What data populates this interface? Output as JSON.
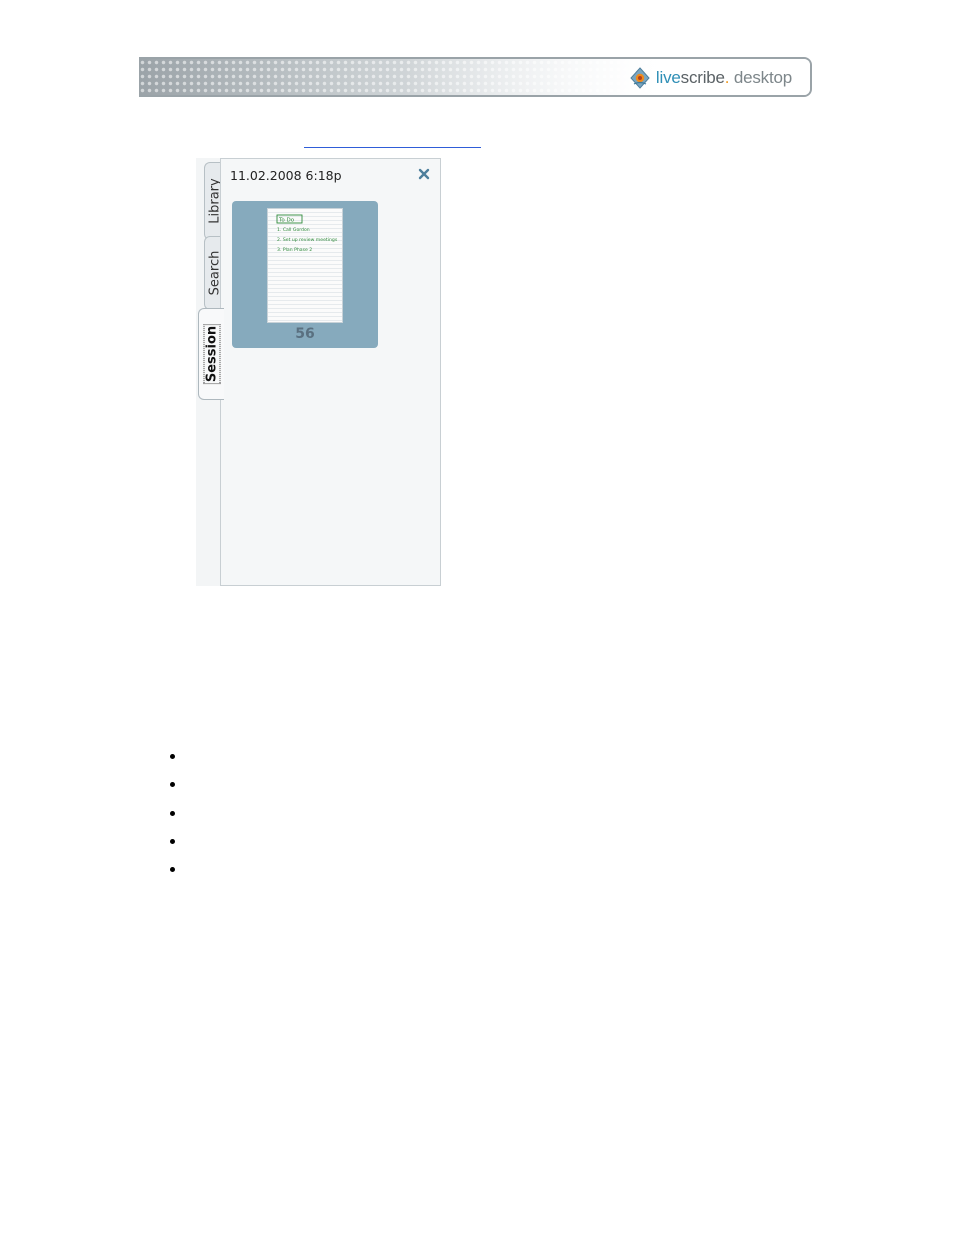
{
  "header": {
    "logo_live": "live",
    "logo_scribe": "scribe",
    "logo_dot": ".",
    "logo_desktop": " desktop",
    "logo_icon": "livescribe-pen-icon",
    "accent_color": "#2f8fb6"
  },
  "sidebar": {
    "tabs": [
      {
        "label": "Library"
      },
      {
        "label": "Search"
      },
      {
        "label": "Session"
      }
    ],
    "active_tab": "Session"
  },
  "session_panel": {
    "title": "11.02.2008 6:18p",
    "close_icon": "close-icon",
    "thumbnail": {
      "page_number": "56",
      "notes": [
        "To Do",
        "1. Call Gordon",
        "2. Set up review meetings",
        "3. Plan Phase 2"
      ]
    }
  },
  "bullet_list": {
    "items": [
      "",
      "",
      "",
      "",
      ""
    ]
  }
}
